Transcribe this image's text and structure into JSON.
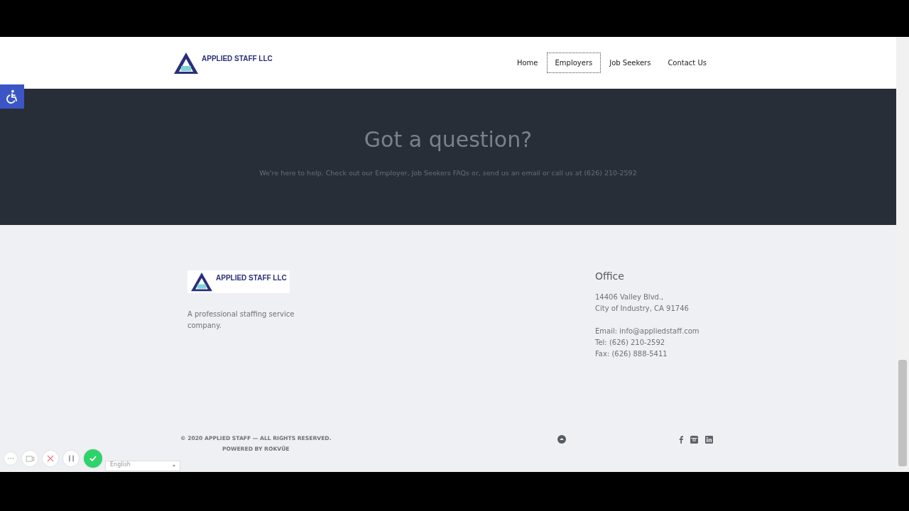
{
  "header": {
    "logo": {
      "name": "APPLIED STAFF LLC"
    },
    "nav": [
      {
        "label": "Home",
        "selected": false
      },
      {
        "label": "Employers",
        "selected": true
      },
      {
        "label": "Job Seekers",
        "selected": false
      },
      {
        "label": "Contact Us",
        "selected": false
      }
    ]
  },
  "cta": {
    "title": "Got a question?",
    "text": "We're here to help. Check out our Employer, Job Seekers FAQs or, send us an email or call us at (626) 210-2592"
  },
  "footer": {
    "logo": {
      "name": "APPLIED STAFF LLC"
    },
    "tagline": "A professional staffing service company.",
    "office": {
      "title": "Office",
      "address": [
        "14406 Valley Blvd.,",
        "City of Industry, CA 91746"
      ],
      "contacts": [
        "Email: info@appliedstaff.com",
        "Tel: (626) 210-2592",
        "Fax: (626) 888-5411"
      ]
    },
    "copyright": "© 2020 APPLIED STAFF — ALL RIGHTS RESERVED.",
    "powered": "POWERED BY ROKVŪE",
    "social": [
      {
        "kind": "facebook"
      },
      {
        "kind": "instagram"
      },
      {
        "kind": "linkedin"
      }
    ]
  },
  "recorder": {
    "buttons": [
      {
        "kind": "more"
      },
      {
        "kind": "camera"
      },
      {
        "kind": "close"
      },
      {
        "kind": "pause"
      },
      {
        "kind": "done"
      }
    ],
    "language": "English"
  }
}
